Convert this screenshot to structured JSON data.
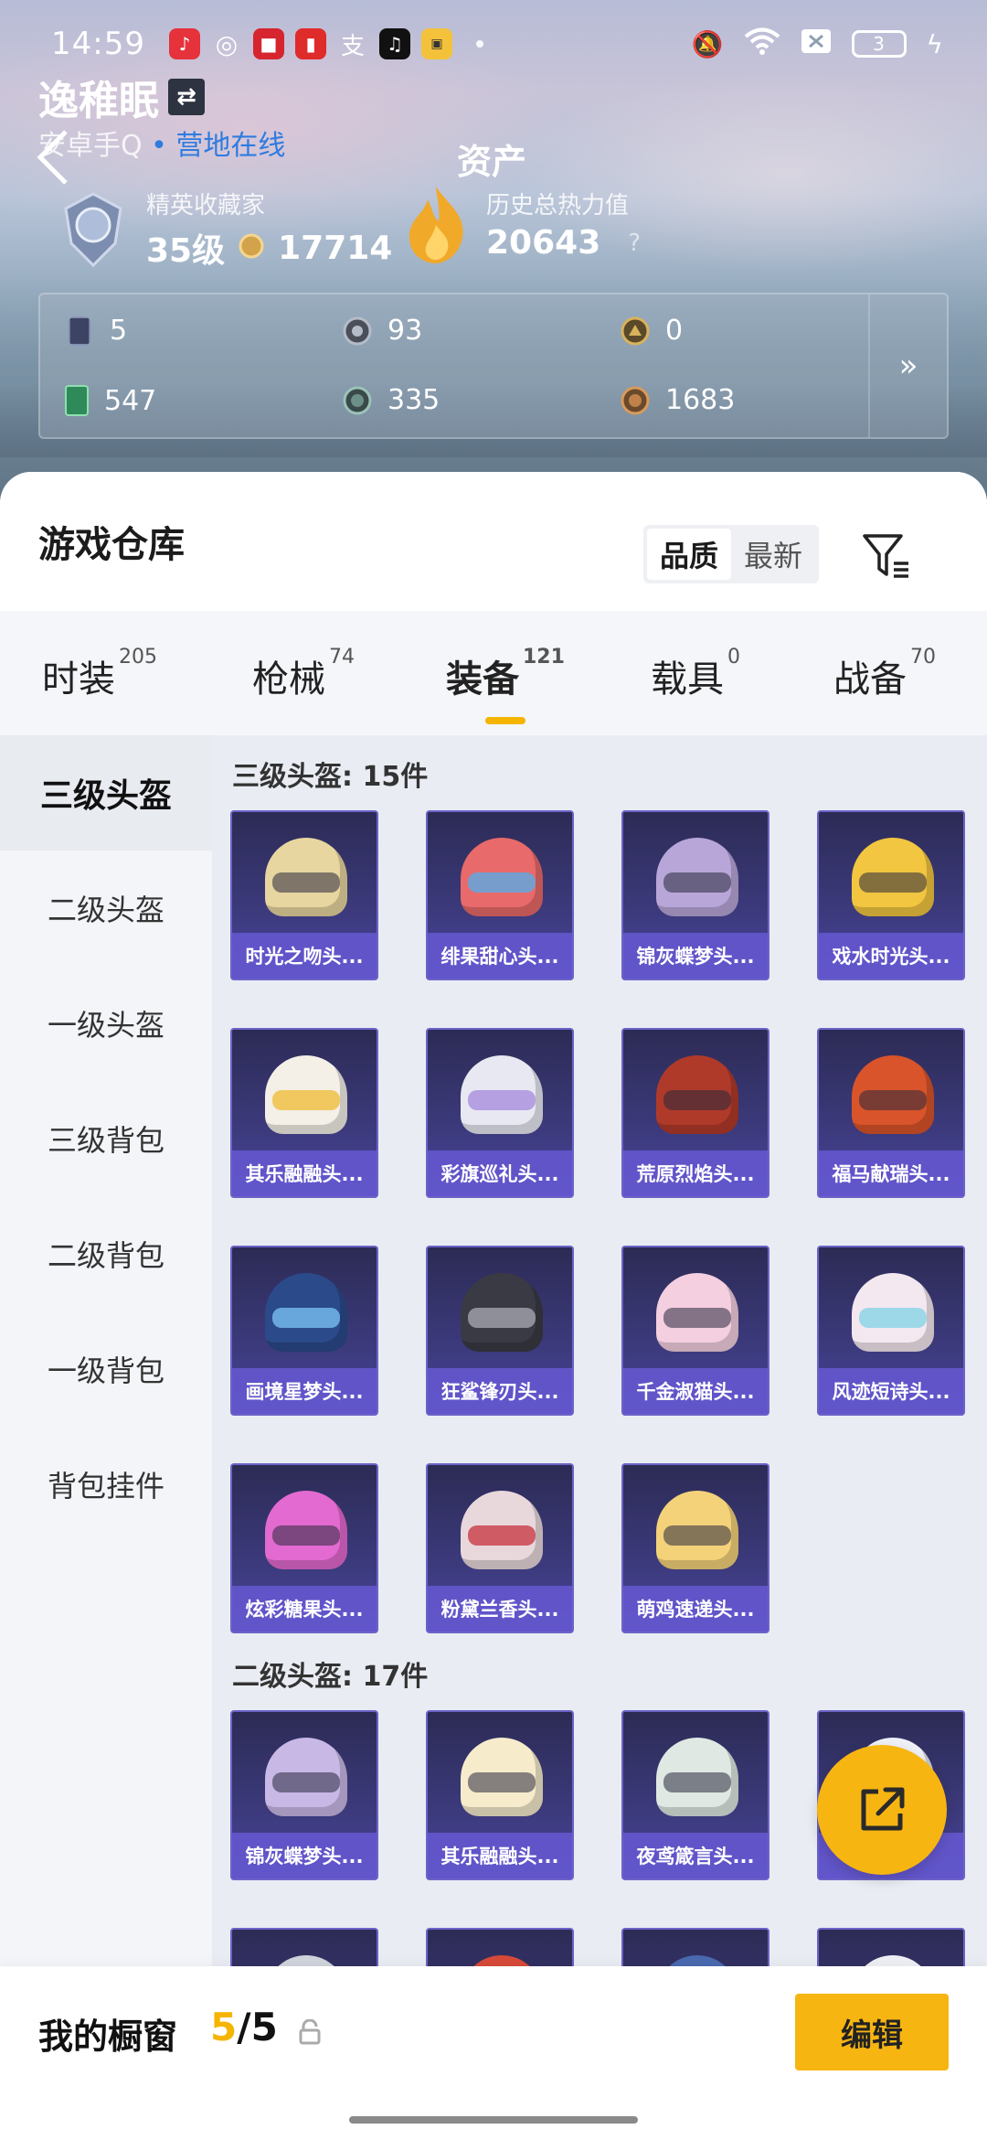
{
  "status_bar": {
    "time": "14:59",
    "battery": "3"
  },
  "profile": {
    "name": "逸稚眠",
    "platform": "安卓手Q",
    "online_status": "营地在线",
    "rank_label": "精英收藏家",
    "level": "35级",
    "coins": "17714",
    "assets_title": "资产",
    "heat_label": "历史总热力值",
    "heat_value": "20643",
    "heat_help": "?"
  },
  "stats": [
    {
      "value": "5",
      "icon": "card-icon"
    },
    {
      "value": "93",
      "icon": "silver-coin-icon"
    },
    {
      "value": "0",
      "icon": "gold-token-icon"
    },
    {
      "value": "547",
      "icon": "ticket-icon"
    },
    {
      "value": "335",
      "icon": "gem-icon"
    },
    {
      "value": "1683",
      "icon": "bronze-coin-icon"
    }
  ],
  "stats_more": "»",
  "warehouse": {
    "title": "游戏仓库",
    "sort_options": [
      "品质",
      "最新"
    ],
    "tabs": [
      {
        "label": "时装",
        "count": "205"
      },
      {
        "label": "枪械",
        "count": "74"
      },
      {
        "label": "装备",
        "count": "121"
      },
      {
        "label": "载具",
        "count": "0"
      },
      {
        "label": "战备",
        "count": "70"
      }
    ],
    "side_items": [
      "三级头盔",
      "二级头盔",
      "一级头盔",
      "三级背包",
      "二级背包",
      "一级背包",
      "背包挂件"
    ],
    "sections": [
      {
        "title": "三级头盔: 15件",
        "items": [
          "时光之吻头...",
          "绯果甜心头...",
          "锦灰蝶梦头...",
          "戏水时光头...",
          "其乐融融头...",
          "彩旗巡礼头...",
          "荒原烈焰头...",
          "福马献瑞头...",
          "画境星梦头...",
          "狂鲨锋刃头...",
          "千金淑猫头...",
          "风迹短诗头...",
          "炫彩糖果头...",
          "粉黛兰香头...",
          "萌鸡速递头..."
        ]
      },
      {
        "title": "二级头盔: 17件",
        "items": [
          "锦灰蝶梦头...",
          "其乐融融头...",
          "夜鸢箴言头...",
          ""
        ]
      }
    ]
  },
  "showcase": {
    "label": "我的橱窗",
    "current": "5",
    "total": "/5",
    "edit_label": "编辑"
  },
  "colors": {
    "accent": "#f7b512",
    "card_bg": "#3c3a7c",
    "online": "#2f7be0"
  }
}
